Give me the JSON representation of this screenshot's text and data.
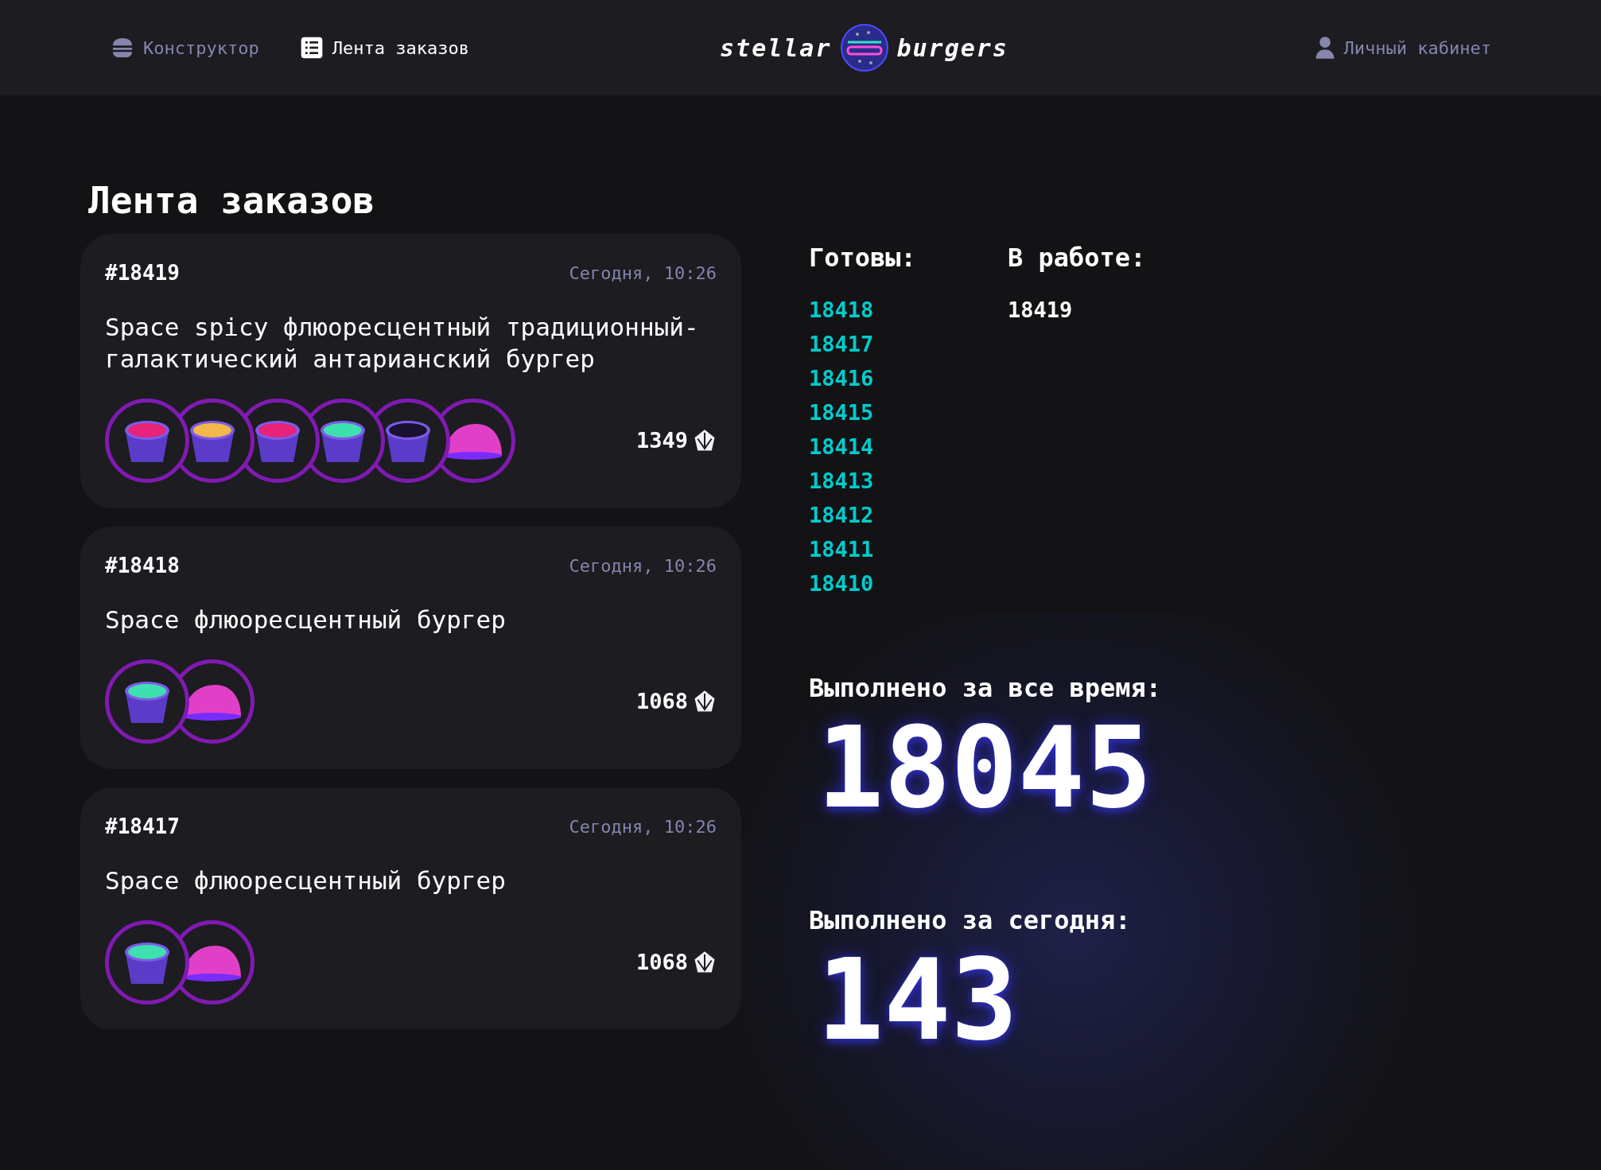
{
  "nav": [
    {
      "kind": "burger",
      "label": "Конструктор",
      "selected": false
    },
    {
      "kind": "list",
      "label": "Лента заказов",
      "selected": true
    }
  ],
  "logo": {
    "left": "stellar",
    "right": "burgers"
  },
  "account": {
    "label": "Личный кабинет",
    "selected": false
  },
  "title": "Лента заказов",
  "orders": [
    {
      "number": "#18419",
      "time": "Сегодня, 10:26",
      "name": "Space spicy флюоресцентный традиционный-галактический антарианский бургер",
      "price": "1349",
      "ingredients": [
        {
          "kind": "sauce",
          "color": "#e8237a"
        },
        {
          "kind": "sauce",
          "color": "#f2b84b"
        },
        {
          "kind": "sauce",
          "color": "#e8237a"
        },
        {
          "kind": "sauce",
          "color": "#3fe0b0"
        },
        {
          "kind": "sauce",
          "color": "#1a1030"
        },
        {
          "kind": "bun",
          "color": "#e040c8"
        }
      ]
    },
    {
      "number": "#18418",
      "time": "Сегодня, 10:26",
      "name": "Space флюоресцентный бургер",
      "price": "1068",
      "ingredients": [
        {
          "kind": "sauce",
          "color": "#3fe0b0"
        },
        {
          "kind": "bun",
          "color": "#e040c8"
        }
      ]
    },
    {
      "number": "#18417",
      "time": "Сегодня, 10:26",
      "name": "Space флюоресцентный бургер",
      "price": "1068",
      "ingredients": [
        {
          "kind": "sauce",
          "color": "#3fe0b0"
        },
        {
          "kind": "bun",
          "color": "#e040c8"
        }
      ]
    }
  ],
  "ready": {
    "heading": "Готовы:",
    "numbers": [
      "18418",
      "18417",
      "18416",
      "18415",
      "18414",
      "18413",
      "18412",
      "18411",
      "18410"
    ]
  },
  "in_progress": {
    "heading": "В работе:",
    "numbers": [
      "18419"
    ]
  },
  "total_all_time": {
    "label": "Выполнено за все время:",
    "value": "18045"
  },
  "total_today": {
    "label": "Выполнено за сегодня:",
    "value": "143"
  }
}
